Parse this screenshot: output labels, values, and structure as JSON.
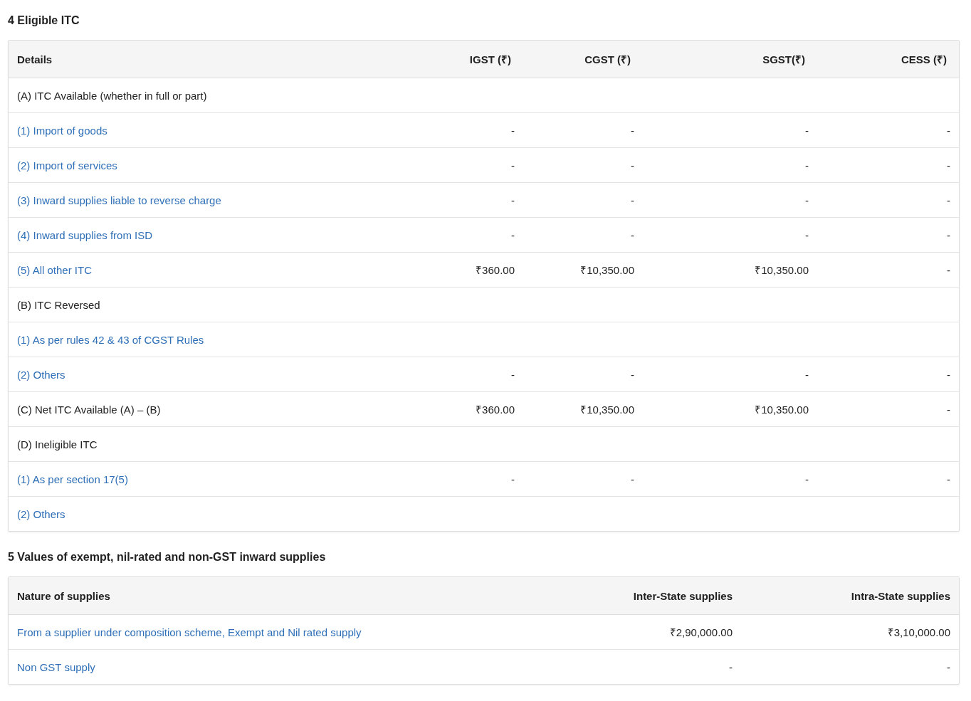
{
  "itc": {
    "title": "4 Eligible ITC",
    "columns": [
      "Details",
      "IGST (₹)",
      "CGST (₹)",
      "SGST(₹)",
      "CESS (₹)"
    ],
    "rows": [
      {
        "kind": "section",
        "label": "(A) ITC Available (whether in full or part)"
      },
      {
        "kind": "item",
        "label": "(1) Import of goods",
        "values": [
          "-",
          "-",
          "-",
          "-"
        ]
      },
      {
        "kind": "item",
        "label": "(2) Import of services",
        "values": [
          "-",
          "-",
          "-",
          "-"
        ]
      },
      {
        "kind": "item",
        "label": "(3) Inward supplies liable to reverse charge",
        "values": [
          "-",
          "-",
          "-",
          "-"
        ]
      },
      {
        "kind": "item",
        "label": "(4) Inward supplies from ISD",
        "values": [
          "-",
          "-",
          "-",
          "-"
        ]
      },
      {
        "kind": "item",
        "label": "(5) All other ITC",
        "values": [
          "₹360.00",
          "₹10,350.00",
          "₹10,350.00",
          "-"
        ]
      },
      {
        "kind": "section",
        "label": "(B) ITC Reversed"
      },
      {
        "kind": "item",
        "label": "(1) As per rules 42 & 43 of CGST Rules"
      },
      {
        "kind": "item",
        "label": "(2) Others",
        "values": [
          "-",
          "-",
          "-",
          "-"
        ]
      },
      {
        "kind": "section",
        "label": "(C) Net ITC Available (A) – (B)",
        "values": [
          "₹360.00",
          "₹10,350.00",
          "₹10,350.00",
          "-"
        ]
      },
      {
        "kind": "section",
        "label": "(D) Ineligible ITC"
      },
      {
        "kind": "item",
        "label": "(1) As per section 17(5)",
        "values": [
          "-",
          "-",
          "-",
          "-"
        ]
      },
      {
        "kind": "item",
        "label": "(2) Others"
      }
    ]
  },
  "exempt": {
    "title": "5 Values of exempt, nil-rated and non-GST inward supplies",
    "columns": [
      "Nature of supplies",
      "Inter-State supplies",
      "Intra-State supplies"
    ],
    "rows": [
      {
        "kind": "item",
        "label": "From a supplier under composition scheme, Exempt and Nil rated supply",
        "values": [
          "₹2,90,000.00",
          "₹3,10,000.00"
        ]
      },
      {
        "kind": "item",
        "label": "Non GST supply",
        "values": [
          "-",
          "-"
        ]
      }
    ]
  }
}
